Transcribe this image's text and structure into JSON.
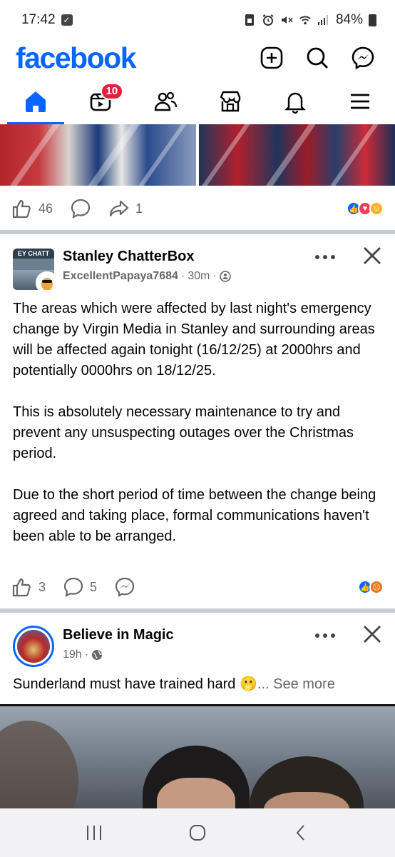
{
  "status_bar": {
    "time": "17:42",
    "battery": "84%"
  },
  "header": {
    "logo": "facebook"
  },
  "nav": {
    "video_badge": "10"
  },
  "post1": {
    "likes": "46",
    "shares": "1"
  },
  "post2": {
    "group_name": "Stanley ChatterBox",
    "avatar_text": "EY CHATT",
    "author": "ExcellentPapaya7684",
    "time": "30m",
    "paragraphs": [
      "The areas which were affected by last night's emergency change by Virgin Media in Stanley and surrounding areas will be affected again tonight (16/12/25) at 2000hrs and potentially 0000hrs on 18/12/25.",
      "This is absolutely necessary maintenance to try and prevent any unsuspecting outages over the Christmas period.",
      "Due to the short period of time between the change being agreed and taking place, formal communications haven't been able to be arranged."
    ],
    "likes": "3",
    "comments": "5"
  },
  "post3": {
    "page_name": "Believe in Magic",
    "time": "19h",
    "text": "Sunderland must have trained hard",
    "emoji": "🫢",
    "see_more": "... See more"
  },
  "colors": {
    "brand": "#0866ff",
    "badge": "#e41e3f",
    "secondary_text": "#65676b"
  }
}
